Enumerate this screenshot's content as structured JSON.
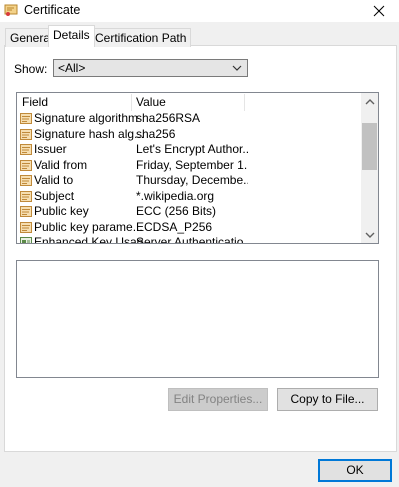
{
  "window": {
    "title": "Certificate"
  },
  "tabs": [
    {
      "label": "General",
      "active": false
    },
    {
      "label": "Details",
      "active": true
    },
    {
      "label": "Certification Path",
      "active": false
    }
  ],
  "show": {
    "label": "Show:",
    "value": "<All>"
  },
  "list": {
    "columns": [
      "Field",
      "Value"
    ],
    "rows": [
      {
        "field": "Signature algorithm",
        "value": "sha256RSA",
        "icon": "certificate-field-icon"
      },
      {
        "field": "Signature hash alg...",
        "value": "sha256",
        "icon": "certificate-field-icon"
      },
      {
        "field": "Issuer",
        "value": "Let's Encrypt Author...",
        "icon": "certificate-field-icon"
      },
      {
        "field": "Valid from",
        "value": "Friday, September 1...",
        "icon": "certificate-field-icon"
      },
      {
        "field": "Valid to",
        "value": "Thursday, Decembe...",
        "icon": "certificate-field-icon"
      },
      {
        "field": "Subject",
        "value": "*.wikipedia.org",
        "icon": "certificate-field-icon"
      },
      {
        "field": "Public key",
        "value": "ECC (256 Bits)",
        "icon": "certificate-field-icon"
      },
      {
        "field": "Public key parame...",
        "value": "ECDSA_P256",
        "icon": "certificate-field-icon"
      },
      {
        "field": "Enhanced Key Usage",
        "value": "Server Authenticatio...",
        "icon": "certificate-extension-icon"
      }
    ]
  },
  "details_text": "",
  "buttons": {
    "edit_properties": "Edit Properties...",
    "copy_to_file": "Copy to File...",
    "ok": "OK"
  },
  "colors": {
    "accent": "#0078d7",
    "background": "#f0f0f0",
    "panel": "#ffffff"
  }
}
